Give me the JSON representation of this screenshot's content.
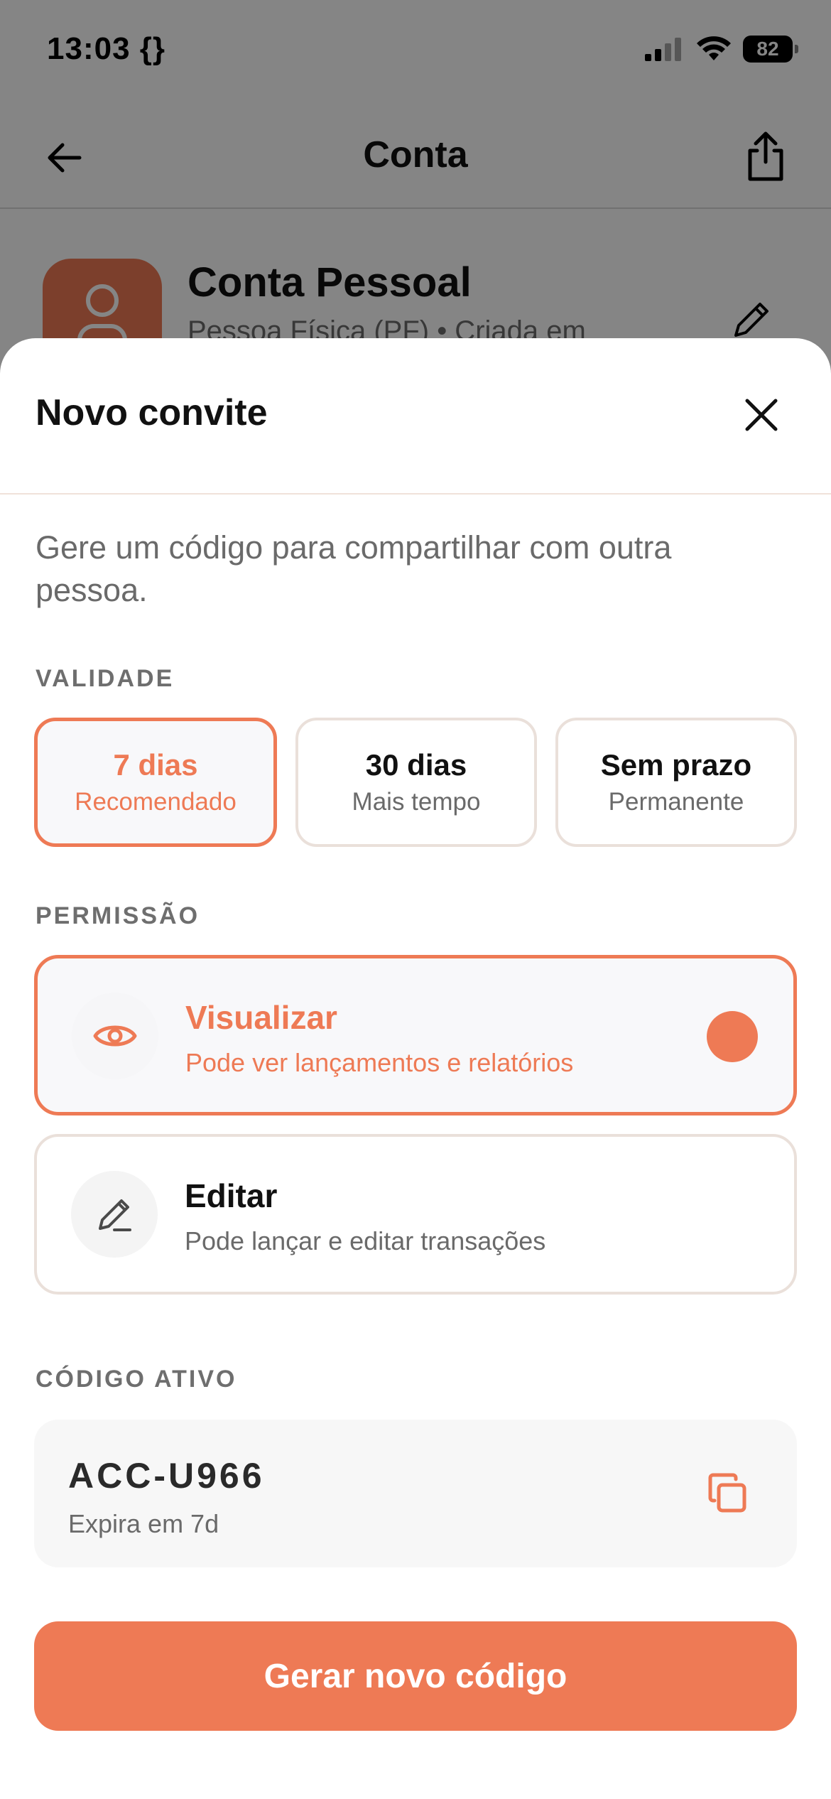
{
  "status_bar": {
    "time": "13:03",
    "time_extra": "{}",
    "battery": "82"
  },
  "nav": {
    "title": "Conta",
    "back_icon": "arrow-left-icon",
    "share_icon": "share-icon"
  },
  "account": {
    "name": "Conta Pessoal",
    "subtitle": "Pessoa Física (PF) • Criada em",
    "avatar_color": "#ee7a55"
  },
  "sheet": {
    "title": "Novo convite",
    "description": "Gere um código para compartilhar com outra pessoa.",
    "validity_label": "VALIDADE",
    "validity_options": [
      {
        "title": "7 dias",
        "subtitle": "Recomendado",
        "selected": true
      },
      {
        "title": "30 dias",
        "subtitle": "Mais tempo",
        "selected": false
      },
      {
        "title": "Sem prazo",
        "subtitle": "Permanente",
        "selected": false
      }
    ],
    "permission_label": "PERMISSÃO",
    "permissions": [
      {
        "title": "Visualizar",
        "subtitle": "Pode ver lançamentos e relatórios",
        "icon": "eye-icon",
        "selected": true
      },
      {
        "title": "Editar",
        "subtitle": "Pode lançar e editar transações",
        "icon": "pencil-icon",
        "selected": false
      }
    ],
    "active_code_label": "CÓDIGO ATIVO",
    "active_code": {
      "code": "ACC-U966",
      "expiry": "Expira em 7d"
    },
    "generate_button": "Gerar novo código"
  },
  "colors": {
    "accent": "#ee7a55",
    "text": "#111111",
    "muted": "#6a6a6a"
  }
}
